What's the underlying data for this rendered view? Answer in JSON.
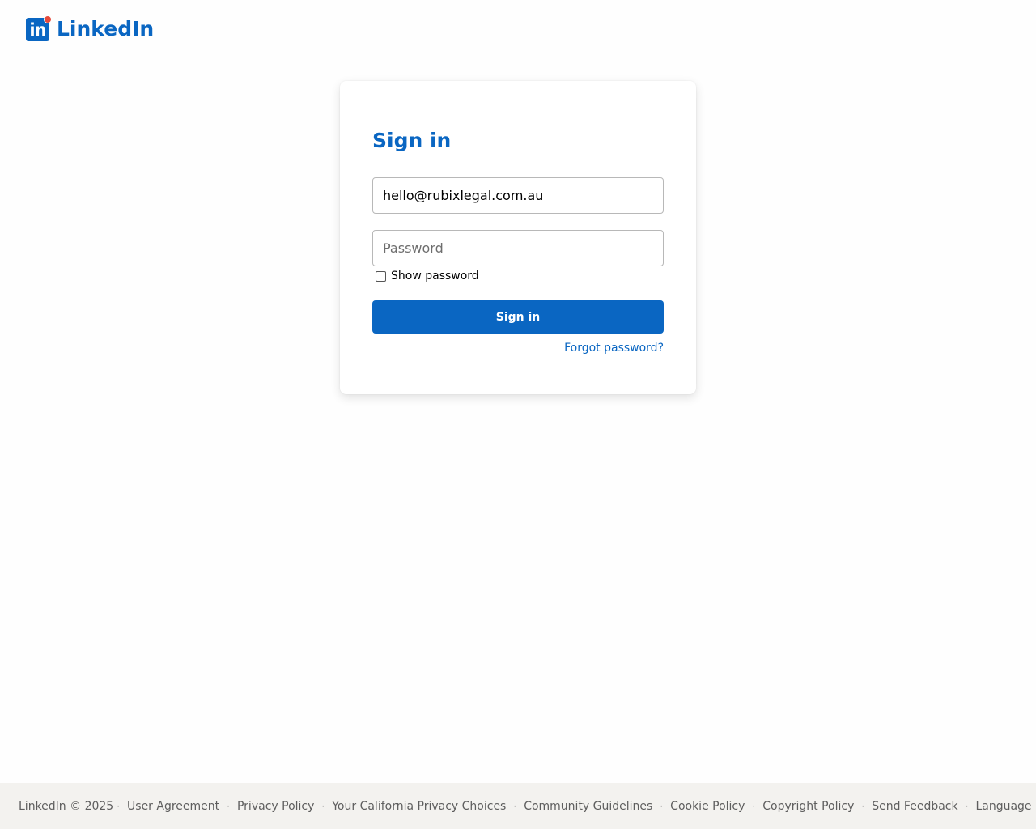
{
  "brand": {
    "name": "LinkedIn",
    "logo_glyph": "in",
    "color": "#0a66c2",
    "notification_dot_color": "#e64a3b"
  },
  "signin": {
    "title": "Sign in",
    "email_value": "hello@rubixlegal.com.au",
    "password_placeholder": "Password",
    "show_password_label": "Show password",
    "show_password_checked": false,
    "submit_label": "Sign in",
    "forgot_label": "Forgot password?"
  },
  "footer": {
    "copyright": "LinkedIn © 2025",
    "separator": "·",
    "links": [
      "User Agreement",
      "Privacy Policy",
      "Your California Privacy Choices",
      "Community Guidelines",
      "Cookie Policy",
      "Copyright Policy",
      "Send Feedback",
      "Language"
    ]
  }
}
